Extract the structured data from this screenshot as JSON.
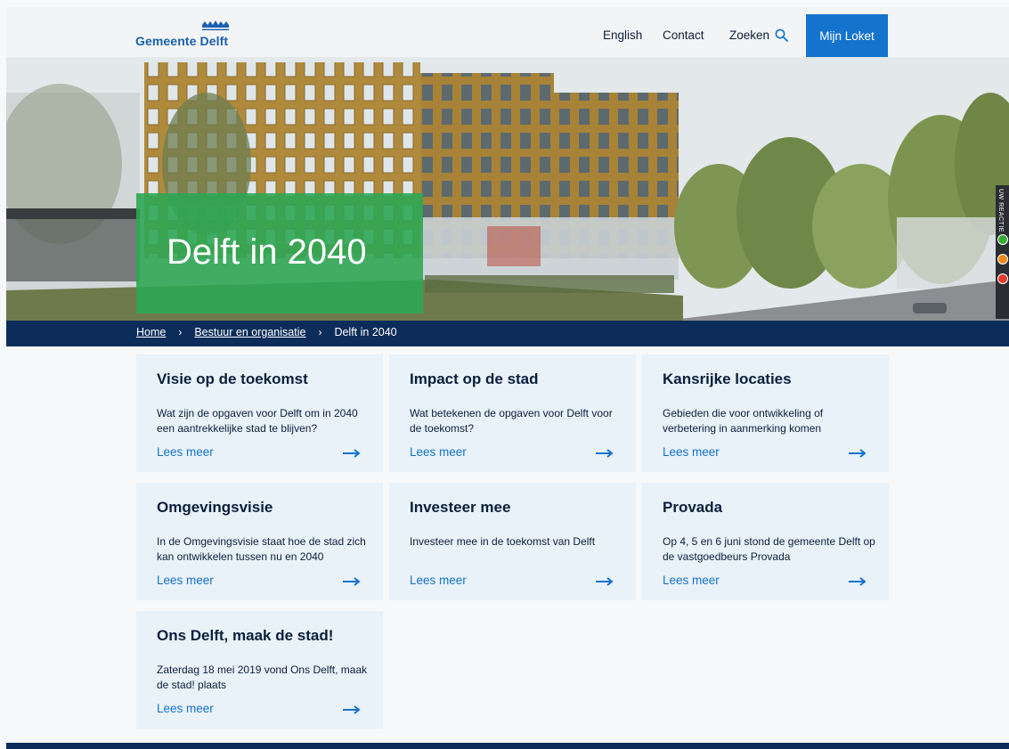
{
  "header": {
    "logo_text": "Gemeente Delft",
    "nav": {
      "english": "English",
      "contact": "Contact",
      "search": "Zoeken",
      "mijn_loket": "Mijn Loket"
    }
  },
  "hero": {
    "title": "Delft in 2040",
    "side_widget_label": "UW REACTIE"
  },
  "breadcrumb": {
    "home": "Home",
    "parent": "Bestuur en organisatie",
    "current": "Delft in 2040",
    "separator": "›"
  },
  "cards": [
    {
      "title": "Visie op de toekomst",
      "desc": "Wat zijn de opgaven voor Delft om in 2040 een aantrekkelijke stad te blijven?",
      "link": "Lees meer"
    },
    {
      "title": "Impact op de stad",
      "desc": "Wat betekenen de opgaven voor Delft voor de toekomst?",
      "link": "Lees meer"
    },
    {
      "title": "Kansrijke locaties",
      "desc": "Gebieden die voor ontwikkeling of verbetering in aanmerking komen",
      "link": "Lees meer"
    },
    {
      "title": "Omgevingsvisie",
      "desc": "In de Omgevingsvisie staat hoe de stad zich kan ontwikkelen tussen nu en 2040",
      "link": "Lees meer"
    },
    {
      "title": "Investeer mee",
      "desc": "Investeer mee in de toekomst van Delft",
      "link": "Lees meer"
    },
    {
      "title": "Provada",
      "desc": "Op 4, 5 en 6 juni stond de gemeente Delft op de vastgoedbeurs Provada",
      "link": "Lees meer"
    },
    {
      "title": "Ons Delft, maak de stad!",
      "desc": "Zaterdag 18 mei 2019 vond Ons Delft, maak de stad! plaats",
      "link": "Lees meer"
    }
  ],
  "colors": {
    "brand_blue": "#1473cc",
    "navy": "#0c2d5a",
    "hero_green": "#2ea654",
    "card_bg": "#e9f1f9"
  },
  "icons": {
    "search": "search-icon",
    "arrow": "arrow-right-icon",
    "logo": "logo-crown-icon"
  }
}
